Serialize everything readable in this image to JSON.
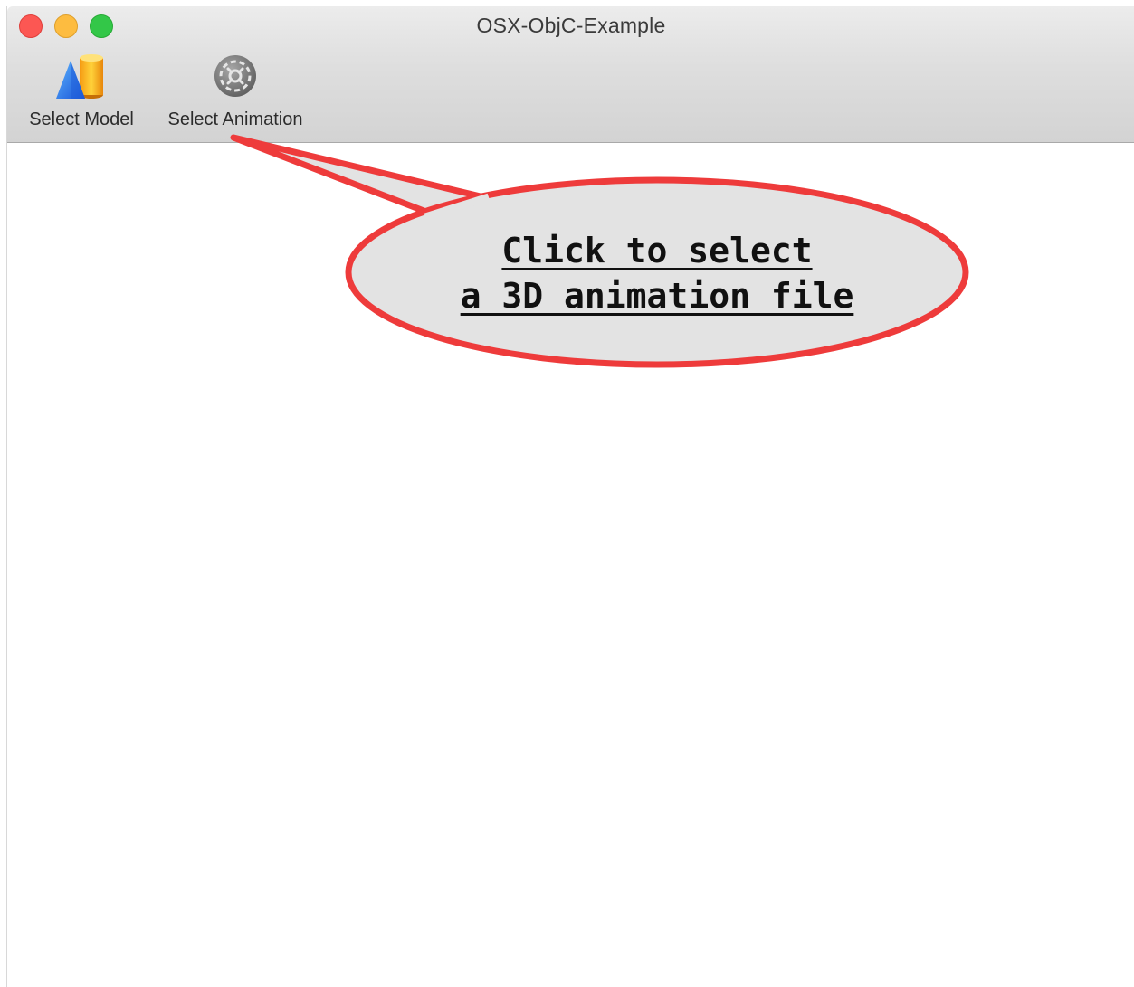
{
  "window": {
    "title": "OSX-ObjC-Example"
  },
  "traffic_lights": {
    "close": "#fc5753",
    "minimize": "#fdbc40",
    "zoom": "#33c748"
  },
  "toolbar": {
    "items": [
      {
        "label": "Select Model",
        "icon": "model-shapes-icon"
      },
      {
        "label": "Select Animation",
        "icon": "animation-gear-icon"
      }
    ]
  },
  "callout": {
    "line1": "Click to select",
    "line2": "a 3D animation file",
    "border_color": "#ee3b3b",
    "fill_color": "#e3e3e3"
  }
}
